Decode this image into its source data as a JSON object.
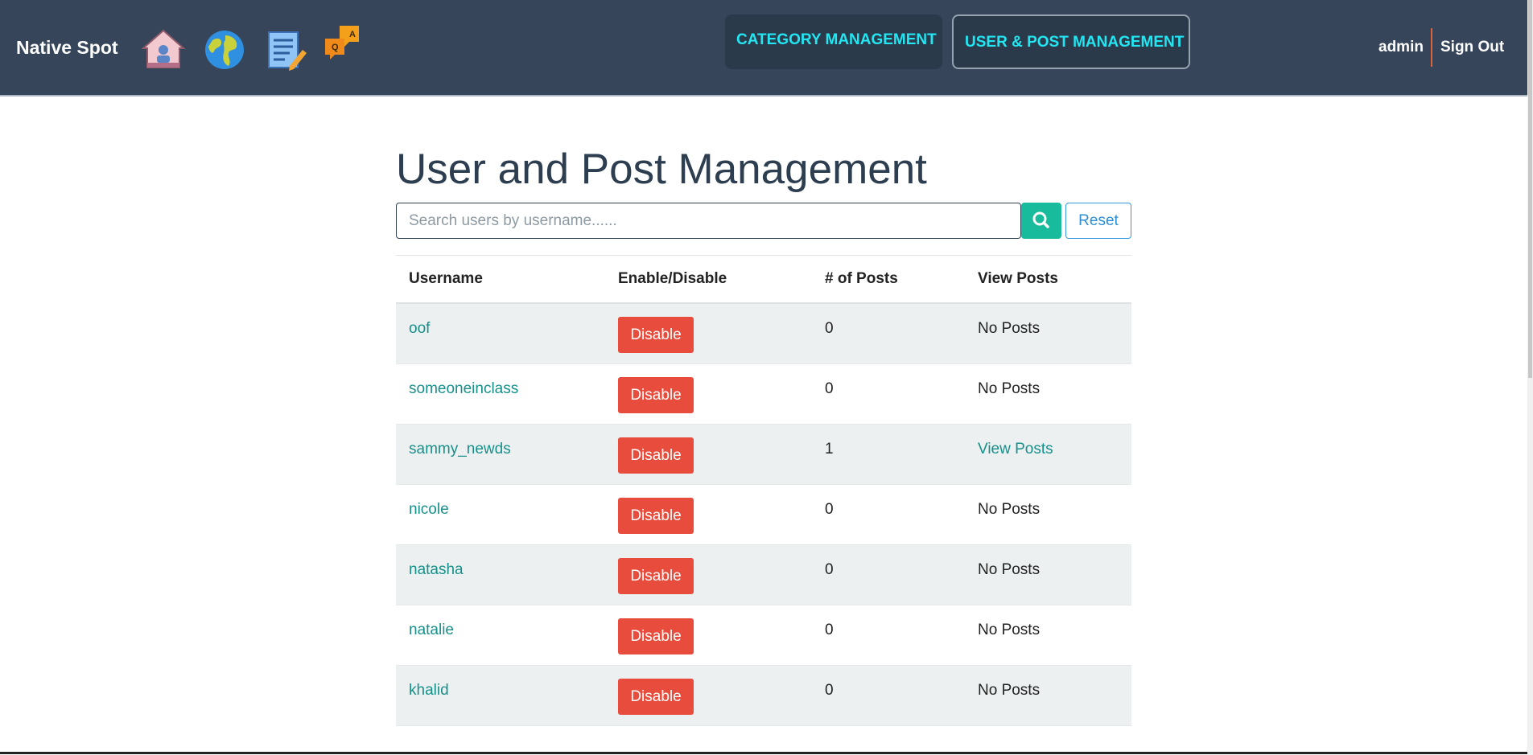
{
  "navbar": {
    "brand": "Native Spot",
    "icons": [
      "home-icon",
      "globe-icon",
      "notepad-icon",
      "qa-chat-icon"
    ],
    "buttons": {
      "category": "CATEGORY MANAGEMENT",
      "user_post": "USER & POST MANAGEMENT"
    },
    "user": "admin",
    "signout": "Sign Out"
  },
  "page": {
    "title": "User and Post Management",
    "search": {
      "placeholder": "Search users by username......",
      "value": ""
    },
    "reset_label": "Reset"
  },
  "table": {
    "headers": [
      "Username",
      "Enable/Disable",
      "# of Posts",
      "View Posts"
    ],
    "rows": [
      {
        "username": "oof",
        "action": "Disable",
        "posts": "0",
        "view": "No Posts"
      },
      {
        "username": "someoneinclass",
        "action": "Disable",
        "posts": "0",
        "view": "No Posts"
      },
      {
        "username": "sammy_newds",
        "action": "Disable",
        "posts": "1",
        "view": "View Posts"
      },
      {
        "username": "nicole",
        "action": "Disable",
        "posts": "0",
        "view": "No Posts"
      },
      {
        "username": "natasha",
        "action": "Disable",
        "posts": "0",
        "view": "No Posts"
      },
      {
        "username": "natalie",
        "action": "Disable",
        "posts": "0",
        "view": "No Posts"
      },
      {
        "username": "khalid",
        "action": "Disable",
        "posts": "0",
        "view": "No Posts"
      }
    ]
  },
  "colors": {
    "navbar_bg": "#364559",
    "nav_text_accent": "#22e6f2",
    "disable_button": "#e74c3c",
    "search_button": "#18bc9c",
    "link": "#17908a"
  }
}
